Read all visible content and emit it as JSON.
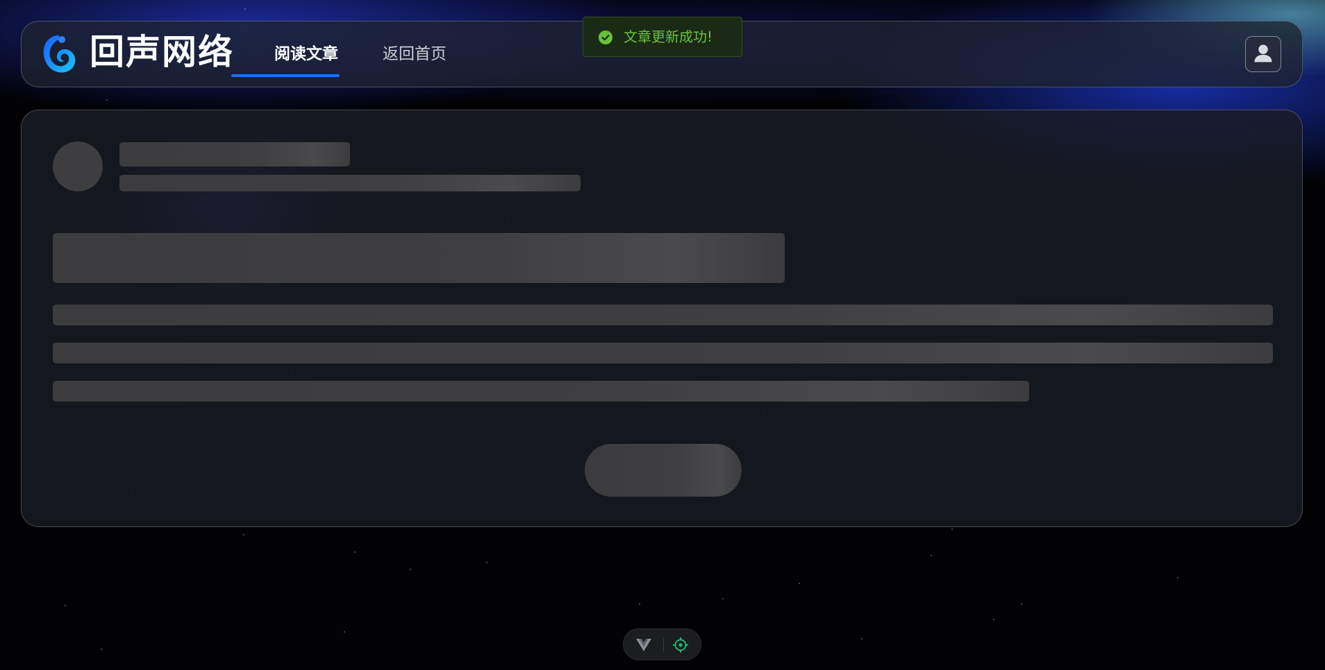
{
  "header": {
    "brand": "回声网络",
    "tabs": [
      {
        "label": "阅读文章",
        "active": true
      },
      {
        "label": "返回首页",
        "active": false
      }
    ],
    "logo_icon": "swirl-logo-icon",
    "user_icon": "user-icon"
  },
  "toast": {
    "message": "文章更新成功!",
    "type": "success",
    "icon": "check-circle-icon"
  },
  "dev_toolbar": {
    "icons": [
      "vue-devtools-icon",
      "target-inspector-icon"
    ]
  },
  "colors": {
    "accent": "#1f6fff",
    "success": "#67c23a",
    "skeleton": "#3e3e40",
    "card_background": "#1a1c24"
  }
}
